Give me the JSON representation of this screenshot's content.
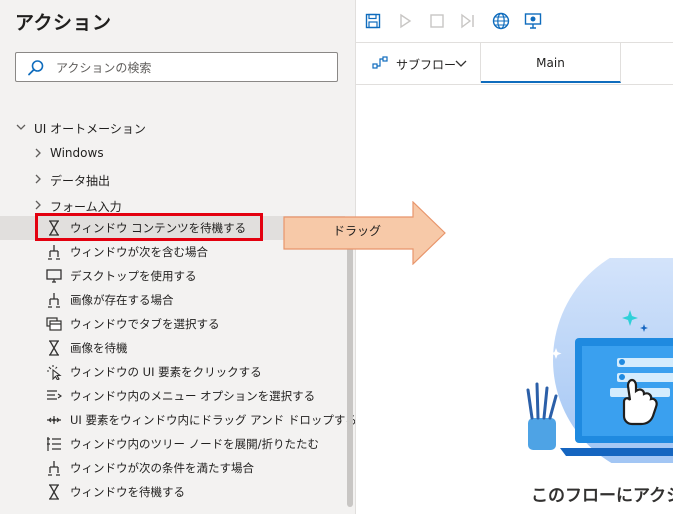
{
  "actions_pane": {
    "title": "アクション",
    "search_placeholder": "アクションの検索",
    "root_category": "UI オートメーション",
    "subcategories": [
      "Windows",
      "データ抽出",
      "フォーム入力"
    ],
    "actions": [
      {
        "label": "ウィンドウ コンテンツを待機する",
        "icon": "hourglass-icon"
      },
      {
        "label": "ウィンドウが次を含む場合",
        "icon": "branch-icon"
      },
      {
        "label": "デスクトップを使用する",
        "icon": "desktop-icon"
      },
      {
        "label": "画像が存在する場合",
        "icon": "branch-icon"
      },
      {
        "label": "ウィンドウでタブを選択する",
        "icon": "tab-window-icon"
      },
      {
        "label": "画像を待機",
        "icon": "hourglass-icon"
      },
      {
        "label": "ウィンドウの UI 要素をクリックする",
        "icon": "cursor-click-icon"
      },
      {
        "label": "ウィンドウ内のメニュー オプションを選択する",
        "icon": "menu-icon"
      },
      {
        "label": "UI 要素をウィンドウ内にドラッグ アンド ドロップする",
        "icon": "drag-drop-icon"
      },
      {
        "label": "ウィンドウ内のツリー ノードを展開/折りたたむ",
        "icon": "tree-node-icon"
      },
      {
        "label": "ウィンドウが次の条件を満たす場合",
        "icon": "branch-icon"
      },
      {
        "label": "ウィンドウを待機する",
        "icon": "hourglass-icon"
      }
    ]
  },
  "designer": {
    "toolbar": [
      "save-icon",
      "run-icon",
      "stop-icon",
      "step-icon",
      "web-recorder-icon",
      "desktop-recorder-icon"
    ],
    "subflow_tab_label": "サブフロー",
    "main_tab_label": "Main",
    "drag_label": "ドラッグ",
    "empty_title": "このフローにアクシ"
  },
  "colors": {
    "accent": "#0f6cbd",
    "highlight_border": "#e3000f",
    "drag_arrow_fill": "#f7c9a8",
    "drag_arrow_stroke": "#e8956b"
  }
}
